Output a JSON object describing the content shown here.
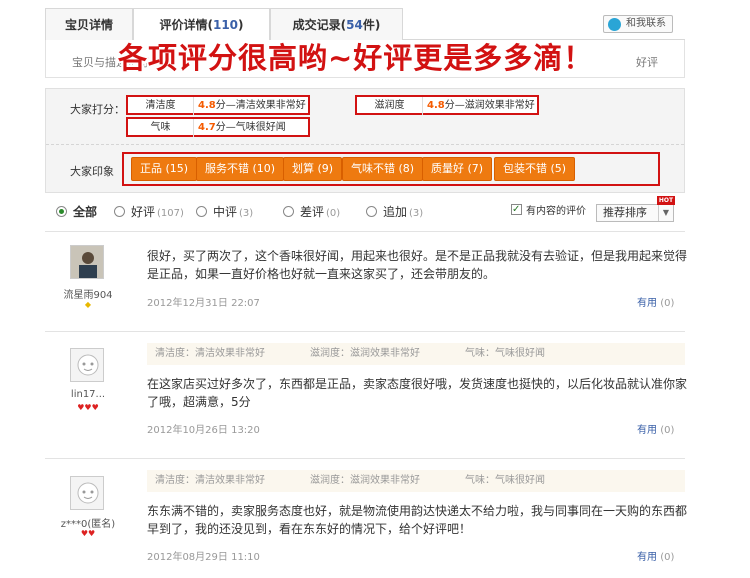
{
  "tabs": [
    {
      "label": "宝贝详情",
      "count": "",
      "suffix": ""
    },
    {
      "label": "评价详情(",
      "count": "110",
      "suffix": ")"
    },
    {
      "label": "成交记录(",
      "count": "54",
      "suffix": "件)"
    }
  ],
  "help_button": "和我联系",
  "info": {
    "desc_visible": "宝贝与描述相符",
    "right_visible": "好评"
  },
  "banner": "各项评分很高哟~好评更是多多滴！",
  "ratings": {
    "label": "大家打分：",
    "items": [
      {
        "name": "清洁度",
        "score": "4.8",
        "desc": "分—清洁效果非常好"
      },
      {
        "name": "滋润度",
        "score": "4.8",
        "desc": "分—滋润效果非常好"
      },
      {
        "name": "气味",
        "score": "4.7",
        "desc": "分—气味很好闻"
      }
    ]
  },
  "impressions": {
    "label": "大家印象",
    "tags": [
      "正品 (15)",
      "服务不错 (10)",
      "划算 (9)",
      "气味不错 (8)",
      "质量好 (7)",
      "包装不错 (5)"
    ]
  },
  "filter": {
    "options": [
      {
        "label": "全部",
        "count": ""
      },
      {
        "label": "好评",
        "count": "(107)"
      },
      {
        "label": "中评",
        "count": "(3)"
      },
      {
        "label": "差评",
        "count": "(0)"
      },
      {
        "label": "追加",
        "count": "(3)"
      }
    ],
    "content_checkbox": "有内容的评价",
    "sort_label": "推荐排序",
    "hot_badge": "HOT"
  },
  "reviews": [
    {
      "user": "流星雨904",
      "text": "很好，买了两次了，这个香味很好闻，用起来也很好。是不是正品我就没有去验证，但是我用起来觉得是正品，如果一直好价格也好就一直来这家买了，还会带朋友的。",
      "date": "2012年12月31日 22:07",
      "useful": "有用",
      "useful_count": "(0)",
      "scores": []
    },
    {
      "user": "lin17...",
      "text": "在这家店买过好多次了，东西都是正品，卖家态度很好哦，发货速度也挺快的，以后化妆品就认准你家了哦，超满意，5分",
      "date": "2012年10月26日 13:20",
      "useful": "有用",
      "useful_count": "(0)",
      "scores": [
        "清洁度：清洁效果非常好",
        "滋润度：滋润效果非常好",
        "气味：气味很好闻"
      ]
    },
    {
      "user": "z***0(匿名)",
      "text": "东东满不错的，卖家服务态度也好，就是物流使用韵达快递太不给力啦，我与同事同在一天购的东西都早到了，我的还没见到，看在东东好的情况下，给个好评吧！",
      "date": "2012年08月29日 11:10",
      "useful": "有用",
      "useful_count": "(0)",
      "scores": [
        "清洁度：清洁效果非常好",
        "滋润度：滋润效果非常好",
        "气味：气味很好闻"
      ]
    }
  ],
  "colors": {
    "accent_red": "#d21212",
    "tag_orange": "#ee7a10",
    "score_orange": "#f55b00",
    "link_blue": "#3a60a8"
  }
}
